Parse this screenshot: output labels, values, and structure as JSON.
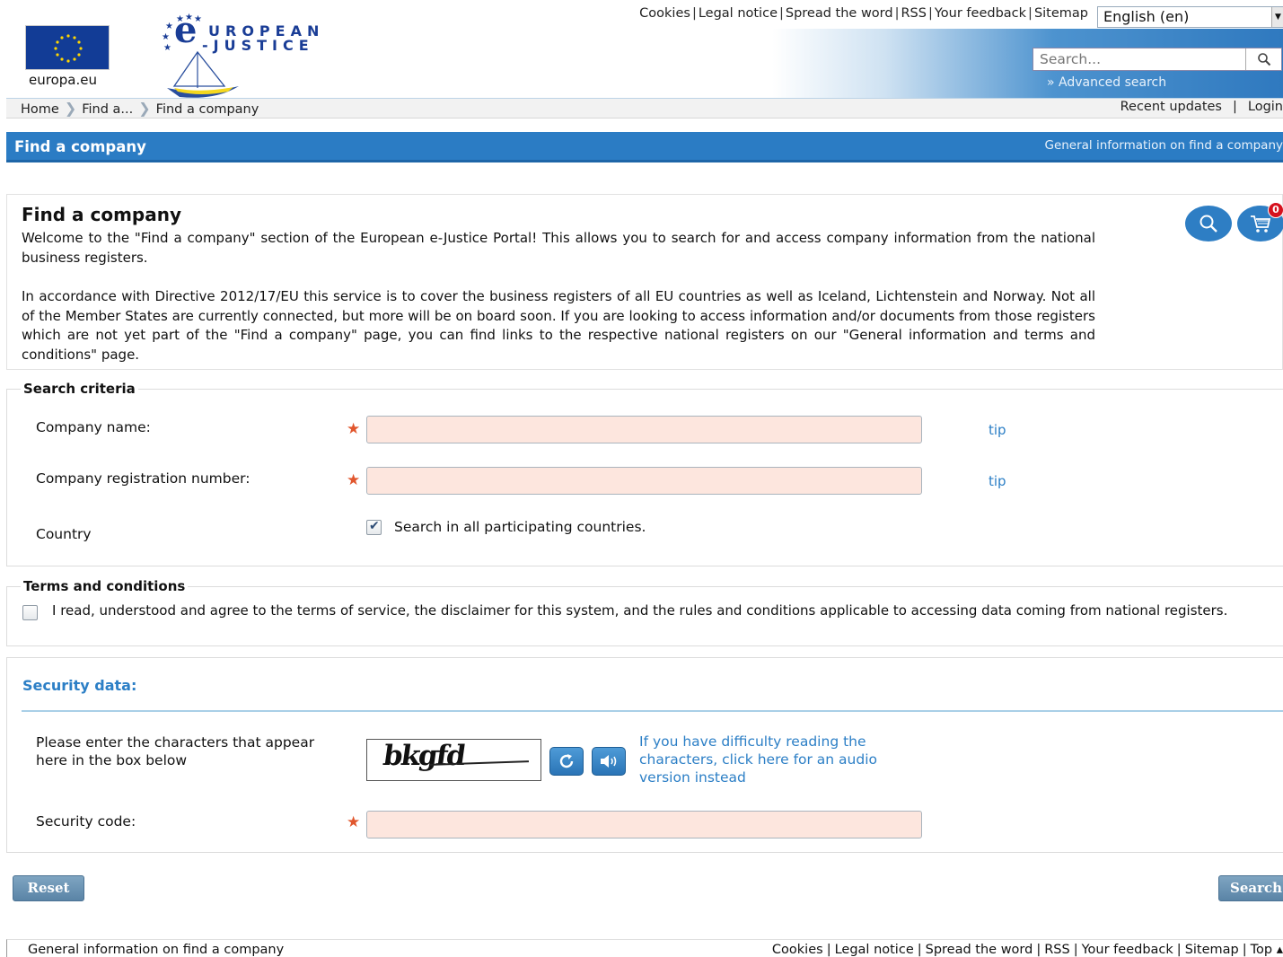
{
  "header": {
    "europa_label": "europa.eu",
    "logo_line1": "UROPEAN",
    "logo_line2": "-JUSTICE",
    "top_links": [
      "Cookies",
      "Legal notice",
      "Spread the word",
      "RSS",
      "Your feedback",
      "Sitemap"
    ],
    "language": "English (en)",
    "search_placeholder": "Search...",
    "advanced_search": "» Advanced search"
  },
  "breadcrumb": [
    "Home",
    "Find a...",
    "Find a company"
  ],
  "bar_right": {
    "recent_updates": "Recent updates",
    "login": "Login"
  },
  "title_bar": {
    "title": "Find a company",
    "info_link": "General information on find a company"
  },
  "intro": {
    "title": "Find a company",
    "p1": "Welcome to the \"Find a company\" section of the European e-Justice Portal! This allows you to search for and access company information from the national business registers.",
    "p2": "In accordance with Directive 2012/17/EU this service is to cover the business registers of all EU countries as well as Iceland, Lichtenstein and Norway. Not all of the Member States are currently connected, but more will be on board soon. If you are looking to access information and/or documents from those registers which are not yet part of the \"Find a company\" page, you can find links to the respective national registers on our \"General information and terms and conditions\" page.",
    "cart_count": "0"
  },
  "search_criteria": {
    "legend": "Search criteria",
    "company_name_label": "Company name:",
    "reg_number_label": "Company registration number:",
    "tip": "tip",
    "country_label": "Country",
    "all_countries_text": "Search in all participating countries.",
    "all_countries_checked": true
  },
  "terms": {
    "legend": "Terms and conditions",
    "text": "I read, understood and agree to the terms of service, the disclaimer for this system, and the rules and conditions applicable to accessing data coming from national registers.",
    "checked": false
  },
  "security": {
    "title": "Security data:",
    "instruction": "Please enter the characters that appear here in the box below",
    "captcha_text": "bkgfd",
    "audio_link": "If you have difficulty reading the characters, click here for an audio version instead",
    "code_label": "Security code:"
  },
  "buttons": {
    "reset": "Reset",
    "search": "Search"
  },
  "footer": {
    "left": "General information on find a company",
    "links": [
      "Cookies",
      "Legal notice",
      "Spread the word",
      "RSS",
      "Your feedback",
      "Sitemap",
      "Top"
    ]
  },
  "colors": {
    "brand_blue": "#2b7cc4",
    "required_star": "#e1562d",
    "field_bg": "#fde6de",
    "link_blue": "#2c7fc6"
  }
}
